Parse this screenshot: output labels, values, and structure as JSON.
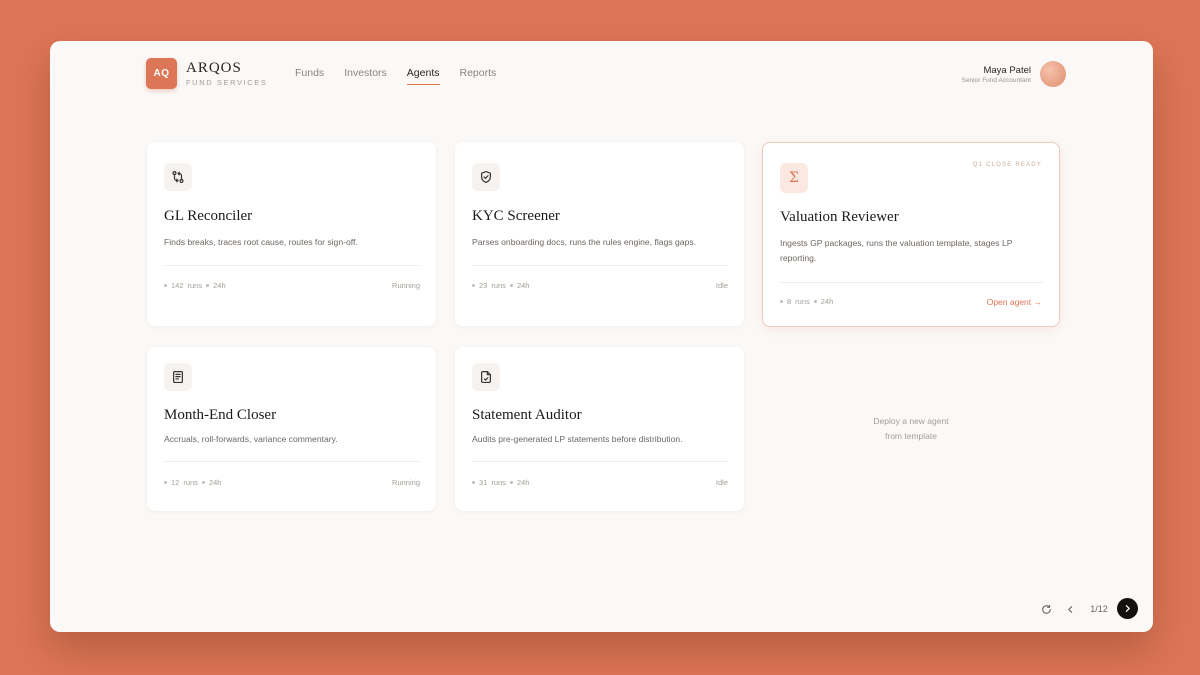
{
  "brand": {
    "badge": "AQ",
    "name": "ARQOS",
    "subtitle": "FUND SERVICES"
  },
  "nav": {
    "items": [
      {
        "label": "Funds",
        "active": false
      },
      {
        "label": "Investors",
        "active": false
      },
      {
        "label": "Agents",
        "active": true
      },
      {
        "label": "Reports",
        "active": false
      }
    ]
  },
  "user": {
    "name": "Maya Patel",
    "role": "Senior Fund Accountant"
  },
  "agents": [
    {
      "icon": "git-compare-icon",
      "title": "GL Reconciler",
      "description": "Finds breaks, traces root cause, routes for sign-off.",
      "runs": "142",
      "runs_label": "runs",
      "window": "24h",
      "status": "Running"
    },
    {
      "icon": "shield-check-icon",
      "title": "KYC Screener",
      "description": "Parses onboarding docs, runs the rules engine, flags gaps.",
      "runs": "23",
      "runs_label": "runs",
      "window": "24h",
      "status": "Idle"
    },
    {
      "icon": "sigma-icon",
      "title": "Valuation Reviewer",
      "description": "Ingests GP packages, runs the valuation template, stages LP reporting.",
      "badge": "Q1 CLOSE READY",
      "runs": "8",
      "runs_label": "runs",
      "window": "24h",
      "link": "Open agent →"
    },
    {
      "icon": "notebook-icon",
      "title": "Month-End Closer",
      "description": "Accruals, roll-forwards, variance commentary.",
      "runs": "12",
      "runs_label": "runs",
      "window": "24h",
      "status": "Running"
    },
    {
      "icon": "document-check-icon",
      "title": "Statement Auditor",
      "description": "Audits pre-generated LP statements before distribution.",
      "runs": "31",
      "runs_label": "runs",
      "window": "24h",
      "status": "Idle"
    }
  ],
  "deploy": {
    "line1": "Deploy a new agent",
    "line2": "from template"
  },
  "pager": {
    "indicator": "1/12"
  },
  "colors": {
    "accent": "#dc7656",
    "background": "#dc7656",
    "surface": "#fbf9f7"
  }
}
